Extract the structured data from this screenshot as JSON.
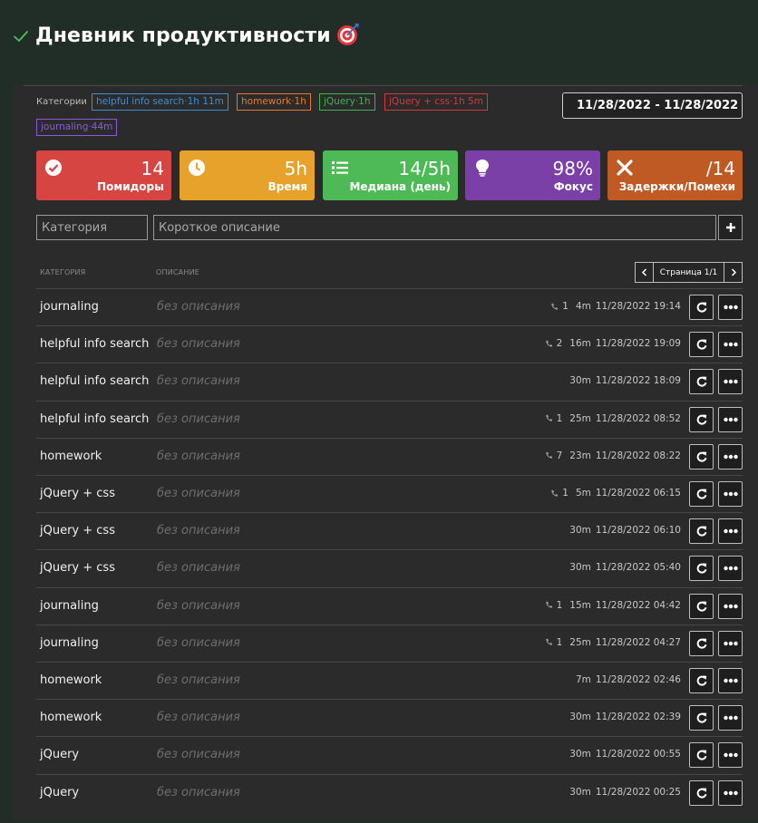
{
  "app": {
    "title": "Дневник продуктивности",
    "check_icon": "check-icon",
    "title_icon": "target-icon"
  },
  "categories": {
    "label": "Категории",
    "tags": [
      {
        "name": "helpful info search",
        "time": "1h 11m",
        "color": "#3a8fd9"
      },
      {
        "name": "homework",
        "time": "1h",
        "color": "#e8782f"
      },
      {
        "name": "jQuery",
        "time": "1h",
        "color": "#3fb34f"
      },
      {
        "name": "jQuery + css",
        "time": "1h 5m",
        "color": "#d9363e"
      },
      {
        "name": "journaling",
        "time": "44m",
        "color": "#8d5bd6"
      }
    ]
  },
  "date_range": {
    "value": "11/28/2022 - 11/28/2022",
    "icon": "calendar-icon"
  },
  "stats": [
    {
      "value": "14",
      "label": "Помидоры",
      "icon": "check-circle-icon",
      "color": "#d64541"
    },
    {
      "value": "5h",
      "label": "Время",
      "icon": "clock-icon",
      "color": "#e6a22a"
    },
    {
      "value": "14/5h",
      "label": "Медиана (день)",
      "icon": "list-icon",
      "color": "#4dba55"
    },
    {
      "value": "98%",
      "label": "Фокус",
      "icon": "lightbulb-icon",
      "color": "#7b3fa8"
    },
    {
      "value": "/14",
      "label": "Задержки/Помехи",
      "icon": "x-icon",
      "color": "#c05a24"
    }
  ],
  "form": {
    "category_placeholder": "Категория",
    "description_placeholder": "Короткое описание",
    "add_icon": "plus-icon"
  },
  "table": {
    "headers": {
      "category": "КАТЕГОРИЯ",
      "description": "ОПИСАНИЕ"
    },
    "pager": {
      "label": "Страница 1/1"
    },
    "rows": [
      {
        "category": "journaling",
        "description": "без описания",
        "calls": "1",
        "duration": "4m",
        "time": "11/28/2022 19:14"
      },
      {
        "category": "helpful info search",
        "description": "без описания",
        "calls": "2",
        "duration": "16m",
        "time": "11/28/2022 19:09"
      },
      {
        "category": "helpful info search",
        "description": "без описания",
        "calls": "",
        "duration": "30m",
        "time": "11/28/2022 18:09"
      },
      {
        "category": "helpful info search",
        "description": "без описания",
        "calls": "1",
        "duration": "25m",
        "time": "11/28/2022 08:52"
      },
      {
        "category": "homework",
        "description": "без описания",
        "calls": "7",
        "duration": "23m",
        "time": "11/28/2022 08:22"
      },
      {
        "category": "jQuery + css",
        "description": "без описания",
        "calls": "1",
        "duration": "5m",
        "time": "11/28/2022 06:15"
      },
      {
        "category": "jQuery + css",
        "description": "без описания",
        "calls": "",
        "duration": "30m",
        "time": "11/28/2022 06:10"
      },
      {
        "category": "jQuery + css",
        "description": "без описания",
        "calls": "",
        "duration": "30m",
        "time": "11/28/2022 05:40"
      },
      {
        "category": "journaling",
        "description": "без описания",
        "calls": "1",
        "duration": "15m",
        "time": "11/28/2022 04:42"
      },
      {
        "category": "journaling",
        "description": "без описания",
        "calls": "1",
        "duration": "25m",
        "time": "11/28/2022 04:27"
      },
      {
        "category": "homework",
        "description": "без описания",
        "calls": "",
        "duration": "7m",
        "time": "11/28/2022 02:46"
      },
      {
        "category": "homework",
        "description": "без описания",
        "calls": "",
        "duration": "30m",
        "time": "11/28/2022 02:39"
      },
      {
        "category": "jQuery",
        "description": "без описания",
        "calls": "",
        "duration": "30m",
        "time": "11/28/2022 00:55"
      },
      {
        "category": "jQuery",
        "description": "без описания",
        "calls": "",
        "duration": "30m",
        "time": "11/28/2022 00:25"
      }
    ]
  }
}
